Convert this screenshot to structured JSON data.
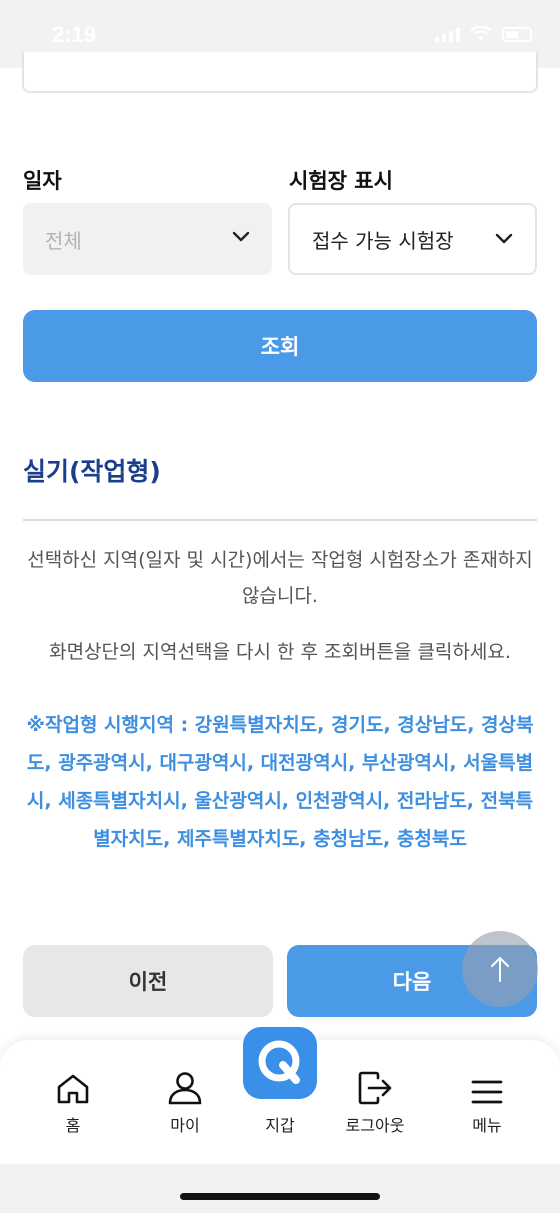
{
  "status_bar": {
    "time": "2:19"
  },
  "filters": {
    "date_label": "일자",
    "date_value": "전체",
    "site_label": "시험장 표시",
    "site_value": "접수 가능 시험장"
  },
  "search_button": "조회",
  "section": {
    "title": "실기(작업형)",
    "message1": "선택하신 지역(일자 및 시간)에서는 작업형 시험장소가 존재하지 않습니다.",
    "message2": "화면상단의 지역선택을 다시 한 후 조회버튼을 클릭하세요.",
    "regions": "※작업형 시행지역 : 강원특별자치도, 경기도, 경상남도, 경상북도, 광주광역시, 대구광역시, 대전광역시, 부산광역시, 서울특별시, 세종특별자치시, 울산광역시, 인천광역시, 전라남도, 전북특별자치도, 제주특별자치도, 충청남도, 충청북도"
  },
  "buttons": {
    "prev": "이전",
    "next": "다음"
  },
  "bottom_nav": {
    "items": [
      {
        "label": "홈",
        "icon": "home-icon"
      },
      {
        "label": "마이",
        "icon": "user-icon"
      },
      {
        "label": "지갑",
        "icon": "wallet-q-icon"
      },
      {
        "label": "로그아웃",
        "icon": "logout-icon"
      },
      {
        "label": "메뉴",
        "icon": "menu-icon"
      }
    ]
  },
  "colors": {
    "primary": "#4a9ae8",
    "title": "#1a3f8c",
    "regions": "#3f8fe0"
  }
}
